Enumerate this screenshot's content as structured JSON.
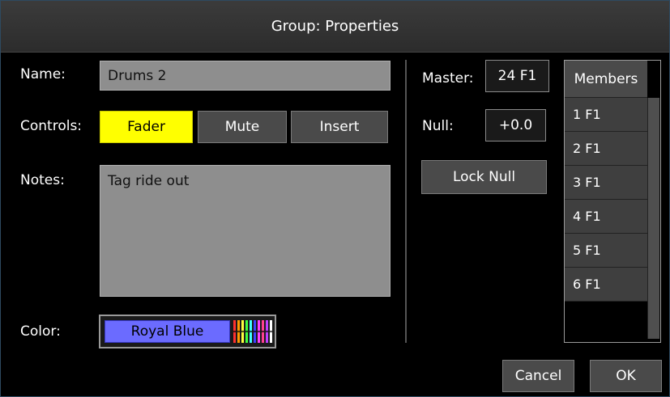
{
  "dialog": {
    "title": "Group: Properties"
  },
  "name": {
    "label": "Name:",
    "value": "Drums 2"
  },
  "controls": {
    "label": "Controls:",
    "buttons": [
      {
        "label": "Fader",
        "active": true
      },
      {
        "label": "Mute",
        "active": false
      },
      {
        "label": "Insert",
        "active": false
      }
    ]
  },
  "notes": {
    "label": "Notes:",
    "value": "Tag ride out"
  },
  "color": {
    "label": "Color:",
    "value": "Royal Blue",
    "swatch": "#6b6bff"
  },
  "master": {
    "label": "Master:",
    "value": "24 F1"
  },
  "null": {
    "label": "Null:",
    "value": "+0.0"
  },
  "lock_null": {
    "label": "Lock Null"
  },
  "members": {
    "header": "Members",
    "items": [
      "1 F1",
      "2 F1",
      "3 F1",
      "4 F1",
      "5 F1",
      "6 F1"
    ]
  },
  "footer": {
    "cancel": "Cancel",
    "ok": "OK"
  },
  "palette_colors": [
    "#ff3030",
    "#ff9a00",
    "#ffff40",
    "#40ff40",
    "#40ffff",
    "#4040ff",
    "#ff40ff",
    "#ff4090",
    "#c040ff",
    "#ffffff"
  ]
}
